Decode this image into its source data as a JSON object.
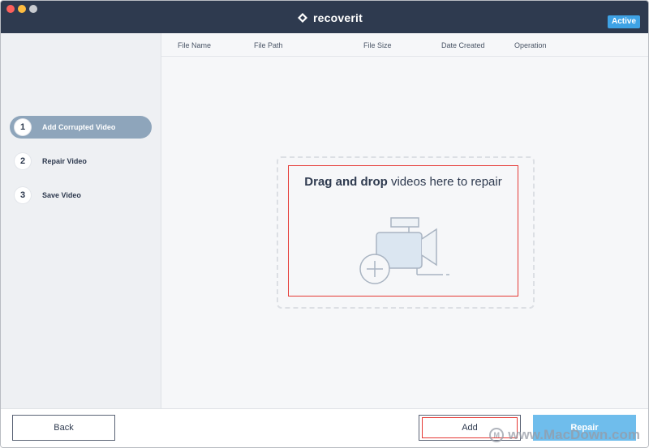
{
  "app": {
    "name": "recoverit",
    "badge": "Active"
  },
  "sidebar": {
    "steps": [
      {
        "number": "1",
        "label": "Add Corrupted Video",
        "active": true
      },
      {
        "number": "2",
        "label": "Repair Video",
        "active": false
      },
      {
        "number": "3",
        "label": "Save Video",
        "active": false
      }
    ]
  },
  "table": {
    "columns": [
      "File Name",
      "File Path",
      "File Size",
      "Date Created",
      "Operation"
    ]
  },
  "dropzone": {
    "bold": "Drag and drop",
    "rest": " videos here to repair",
    "icon": "video-camera-add-icon"
  },
  "footer": {
    "back_label": "Back",
    "add_label": "Add",
    "repair_label": "Repair"
  },
  "watermark": {
    "logo": "M",
    "text": "www.MacDown.com"
  },
  "colors": {
    "titlebar": "#2e3a4f",
    "accent": "#3ea2e5",
    "active_step": "#8ea5bb",
    "repair_button": "#6fbdec"
  }
}
